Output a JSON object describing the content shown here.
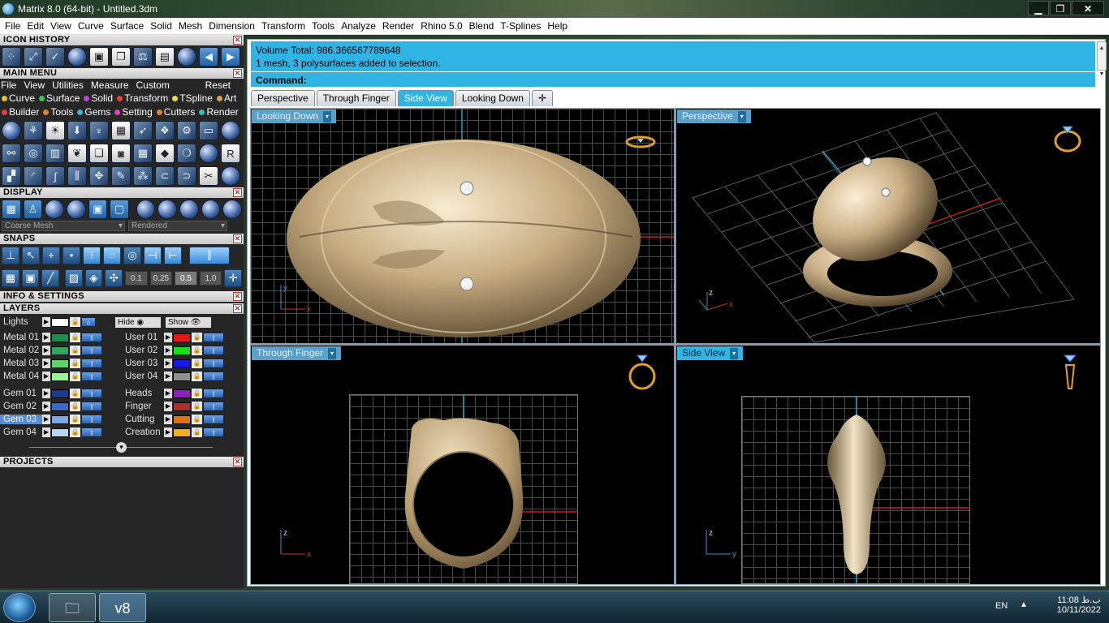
{
  "window": {
    "title": "Matrix 8.0 (64-bit) - Untitled.3dm",
    "min": "▁",
    "max": "❐",
    "close": "✕"
  },
  "menubar": [
    "File",
    "Edit",
    "View",
    "Curve",
    "Surface",
    "Solid",
    "Mesh",
    "Dimension",
    "Transform",
    "Tools",
    "Analyze",
    "Render",
    "Rhino 5.0",
    "Blend",
    "T-Splines",
    "Help"
  ],
  "panels": {
    "icon_history": "ICON HISTORY",
    "main_menu": "MAIN MENU",
    "display": "DISPLAY",
    "snaps": "SNAPS",
    "info": "INFO & SETTINGS",
    "layers": "LAYERS",
    "projects": "PROJECTS"
  },
  "main_menu": {
    "items": [
      "File",
      "View",
      "Utilities",
      "Measure",
      "Custom"
    ],
    "reset": "Reset",
    "cats1": [
      {
        "label": "Curve",
        "color": "#e0c040"
      },
      {
        "label": "Surface",
        "color": "#40c060"
      },
      {
        "label": "Solid",
        "color": "#c040e0"
      },
      {
        "label": "Transform",
        "color": "#e04040"
      },
      {
        "label": "TSpline",
        "color": "#e0e040"
      },
      {
        "label": "Art",
        "color": "#e0a040"
      }
    ],
    "cats2": [
      {
        "label": "Builder",
        "color": "#e04040"
      },
      {
        "label": "Tools",
        "color": "#e08030"
      },
      {
        "label": "Gems",
        "color": "#40b0e0"
      },
      {
        "label": "Setting",
        "color": "#e040c0"
      },
      {
        "label": "Cutters",
        "color": "#e08030"
      },
      {
        "label": "Render",
        "color": "#30c0c0"
      }
    ]
  },
  "display": {
    "mesh": "Coarse Mesh",
    "mode": "Rendered"
  },
  "snaps": {
    "values": [
      "0.1",
      "0.25",
      "0.5",
      "1.0"
    ]
  },
  "layers": {
    "lights": "Lights",
    "hide": "Hide",
    "show": "Show",
    "left": [
      {
        "name": "Metal 01",
        "color": "#1e8a50"
      },
      {
        "name": "Metal 02",
        "color": "#2ea860"
      },
      {
        "name": "Metal 03",
        "color": "#5cd46a"
      },
      {
        "name": "Metal 04",
        "color": "#9ef29a"
      },
      {
        "name": "Gem 01",
        "color": "#1e3a90"
      },
      {
        "name": "Gem 02",
        "color": "#3a68c8"
      },
      {
        "name": "Gem 03",
        "color": "#7aa8e8"
      },
      {
        "name": "Gem 04",
        "color": "#b8d4f4"
      }
    ],
    "right": [
      {
        "name": "User 01",
        "color": "#e01818"
      },
      {
        "name": "User 02",
        "color": "#18e018"
      },
      {
        "name": "User 03",
        "color": "#1818e0"
      },
      {
        "name": "User 04",
        "color": "#909090"
      },
      {
        "name": "Heads",
        "color": "#8a20c0"
      },
      {
        "name": "Finger",
        "color": "#b03030"
      },
      {
        "name": "Cutting",
        "color": "#e07010"
      },
      {
        "name": "Creation",
        "color": "#f0b020"
      }
    ]
  },
  "command": {
    "line1": "Volume Total: 986.366567789648",
    "line2": "1 mesh, 3 polysurfaces added to selection.",
    "prompt": "Command:"
  },
  "tabs": [
    "Perspective",
    "Through Finger",
    "Side View",
    "Looking Down"
  ],
  "viewports": {
    "tl": "Looking Down",
    "tr": "Perspective",
    "bl": "Through Finger",
    "br": "Side View"
  },
  "axes": {
    "x": "x",
    "y": "y",
    "z": "z"
  },
  "taskbar": {
    "lang": "EN",
    "time": "11:08 ب.ظ",
    "date": "10/11/2022",
    "app": "v8"
  }
}
